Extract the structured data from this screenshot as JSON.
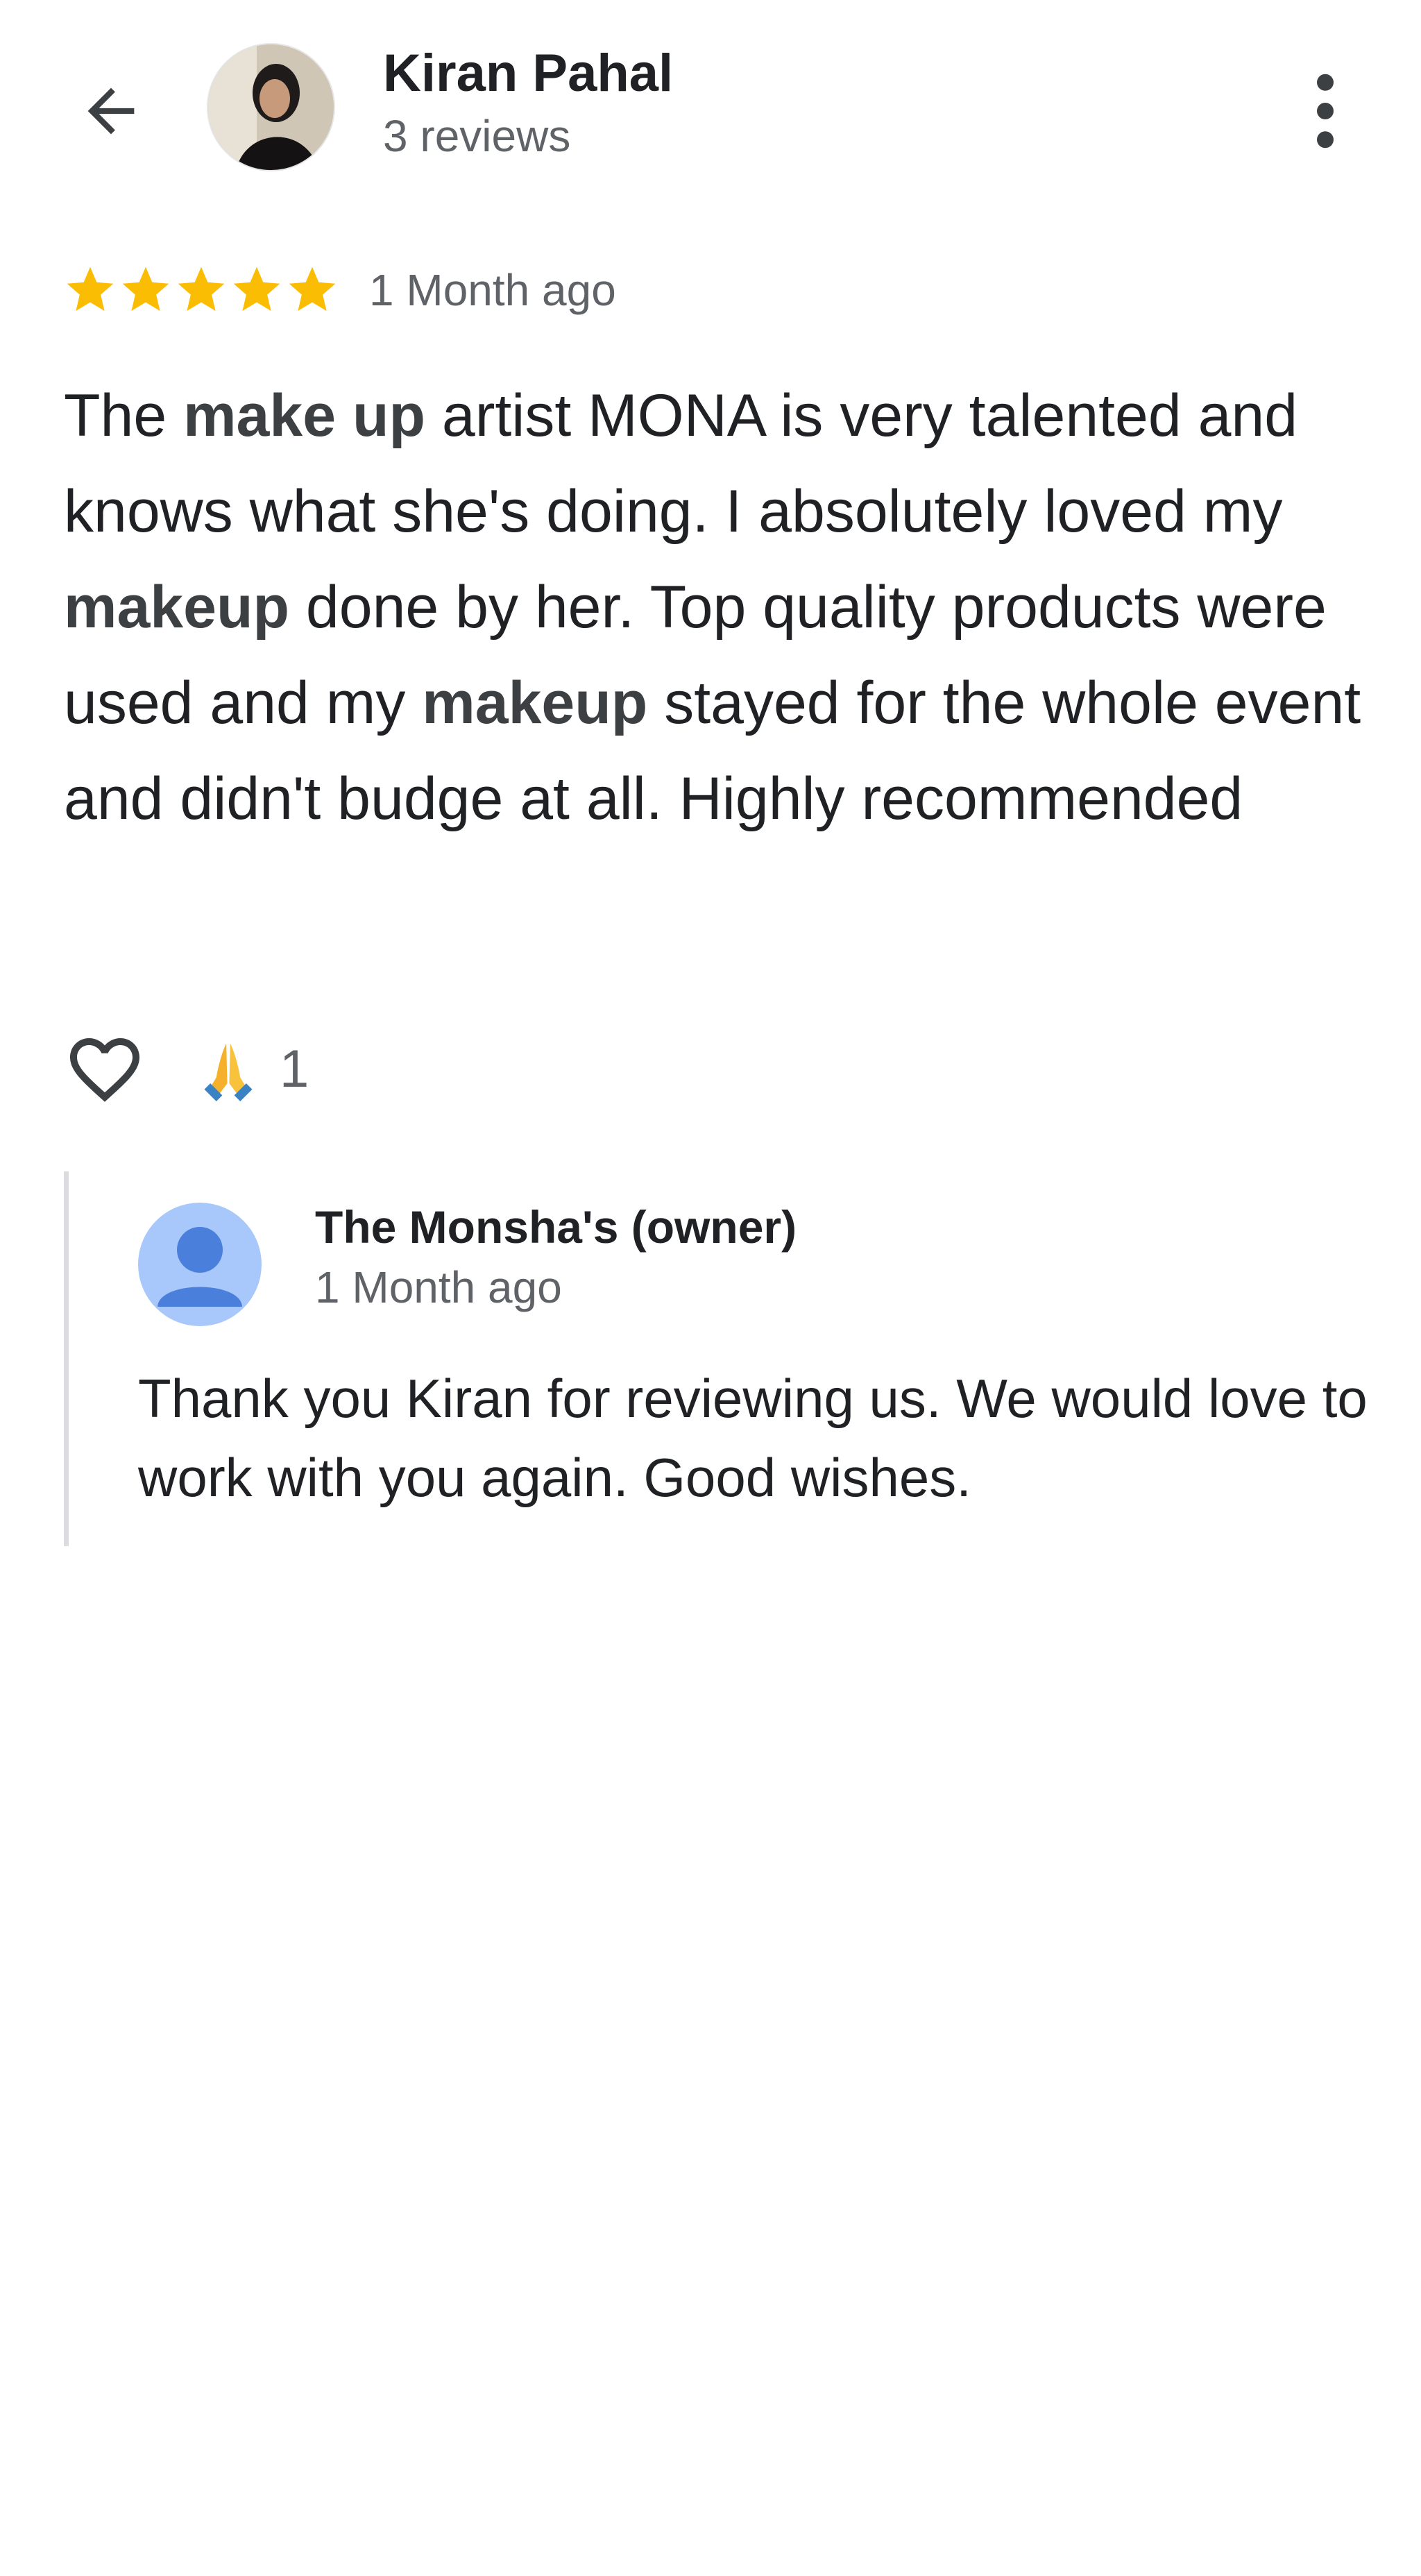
{
  "header": {
    "back_icon": "arrow-back-icon",
    "reviewer_name": "Kiran Pahal",
    "review_count": "3 reviews",
    "more_icon": "more-vert-icon"
  },
  "review": {
    "rating": 5,
    "max_rating": 5,
    "star_color": "#fbbc04",
    "time": "1 Month ago",
    "text_parts": [
      {
        "text": "The ",
        "bold": false
      },
      {
        "text": "make up",
        "bold": true
      },
      {
        "text": " artist MONA is very talented and knows what she's doing. I absolutely loved my ",
        "bold": false
      },
      {
        "text": "makeup",
        "bold": true
      },
      {
        "text": " done by her. Top quality products were used and my ",
        "bold": false
      },
      {
        "text": "makeup",
        "bold": true
      },
      {
        "text": " stayed for the whole event and didn't budge at all. Highly recommended",
        "bold": false
      }
    ]
  },
  "reactions": {
    "like_icon": "heart-outline-icon",
    "emoji_icon": "folded-hands-icon",
    "count": "1"
  },
  "owner_reply": {
    "avatar_icon": "person-icon",
    "name": "The Monsha's (owner)",
    "time": "1 Month ago",
    "text": "Thank you Kiran for reviewing us. We would love to work with you again. Good wishes."
  },
  "colors": {
    "text_primary": "#202124",
    "text_secondary": "#5f6368",
    "divider": "#dadce0",
    "avatar_bg": "#a8c7fa",
    "avatar_fg": "#4a7fdc"
  }
}
